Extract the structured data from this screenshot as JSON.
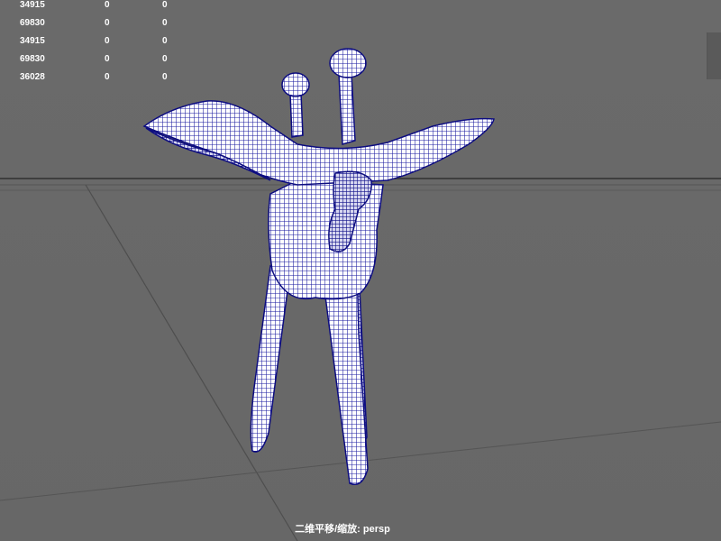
{
  "hud": {
    "rows": [
      [
        "34915",
        "0",
        "0"
      ],
      [
        "69830",
        "0",
        "0"
      ],
      [
        "34915",
        "0",
        "0"
      ],
      [
        "69830",
        "0",
        "0"
      ],
      [
        "36028",
        "0",
        "0"
      ]
    ]
  },
  "viewport": {
    "camera_label": "二维平移/缩放: persp",
    "background_color": "#686868",
    "grid_color": "#4a4a4a",
    "wireframe_color": "#1a1aa0",
    "mesh_fill_color": "#ffffff"
  },
  "model": {
    "icon": "bronze-jue-vessel-wireframe"
  }
}
